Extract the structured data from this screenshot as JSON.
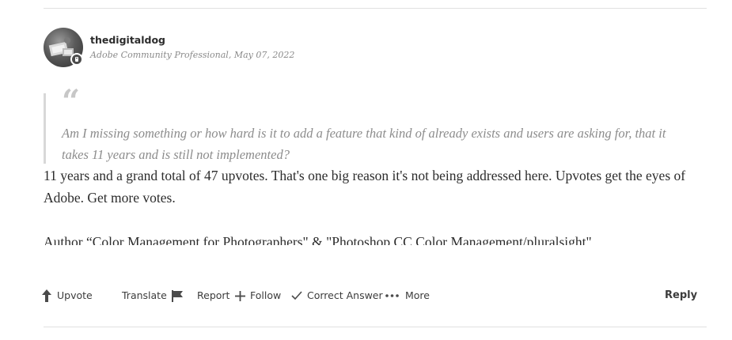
{
  "post": {
    "author": {
      "username": "thedigitaldog",
      "role": "Adobe Community Professional",
      "separator": ",",
      "date": "May 07, 2022"
    },
    "quote": {
      "mark": "“",
      "text": "Am I missing something or how hard is it to add a feature that kind of already exists and users are asking for, that it takes 11 years and is still not implemented?"
    },
    "body": "11 years and a grand total of 47 upvotes. That's one big reason it's not being addressed here. Upvotes get the eyes of Adobe. Get more votes.",
    "signature": "Author “Color Management for Photographers\" & \"Photoshop CC Color Management/pluralsight\""
  },
  "actions": {
    "upvote": {
      "label": "Upvote",
      "icon": "arrow-up-icon"
    },
    "translate": {
      "label": "Translate"
    },
    "report": {
      "label": "Report",
      "icon": "flag-icon"
    },
    "follow": {
      "label": "Follow",
      "icon": "plus-icon"
    },
    "correct_answer": {
      "label": "Correct Answer",
      "icon": "checkmark-icon"
    },
    "more": {
      "label": "More",
      "icon": "more-dots-icon"
    },
    "reply": {
      "label": "Reply"
    }
  },
  "colors": {
    "text": "#2c2c2c",
    "muted": "#8a8a8a",
    "quote_bar": "#d8d8d8",
    "divider": "#e1e1e1"
  }
}
